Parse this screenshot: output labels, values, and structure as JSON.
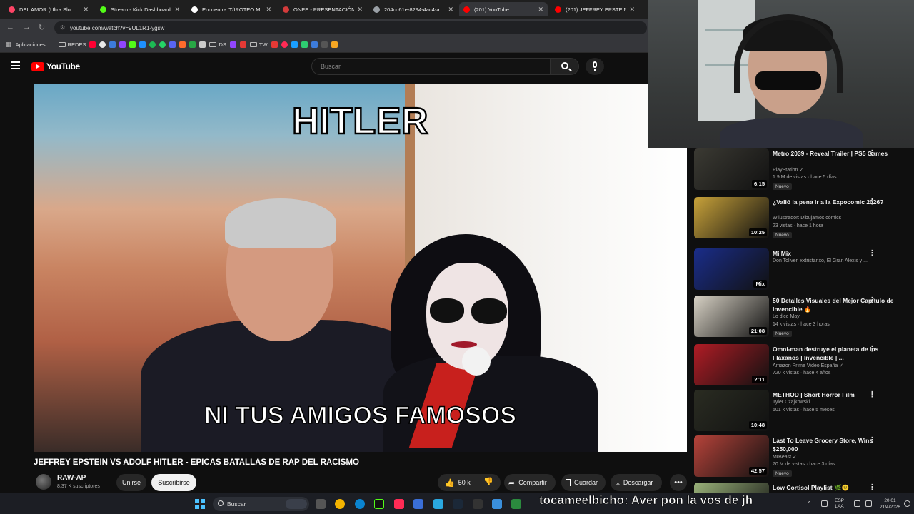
{
  "browser": {
    "tabs": [
      {
        "title": "DEL AMOR (Ultra Slo",
        "color": "#ff4466",
        "active": false
      },
      {
        "title": "Stream - Kick Dashboard",
        "color": "#53fc18",
        "active": false
      },
      {
        "title": "Encuentra 'T/IROTEO MI",
        "color": "#ffffff",
        "active": false
      },
      {
        "title": "ONPE - PRESENTACIÓN",
        "color": "#d33b3b",
        "active": false
      },
      {
        "title": "204cd61e-8294-4ac4-a",
        "color": "#9aa0a6",
        "active": false
      },
      {
        "title": "(201) YouTube",
        "color": "#ff0000",
        "active": true
      },
      {
        "title": "(201) JEFFREY EPSTEIN V",
        "color": "#ff0000",
        "active": false
      }
    ],
    "url": "youtube.com/watch?v=9UL1R1-ygsw",
    "bookmarks": {
      "apps_label": "Aplicaciones",
      "folders": [
        "REDES",
        "DS",
        "TW"
      ]
    }
  },
  "youtube": {
    "logo_text": "YouTube",
    "search_placeholder": "Buscar",
    "video": {
      "caption_top": "HITLER",
      "caption_bottom": "NI TUS AMIGOS FAMOSOS",
      "title": "JEFFREY EPSTEIN VS ADOLF HITLER - EPICAS BATALLAS DE RAP DEL RACISMO",
      "channel": "RAW-AP",
      "subscribers": "8.37 K suscriptores",
      "join_label": "Unirse",
      "subscribe_label": "Suscribirse",
      "likes": "50 k",
      "share_label": "Compartir",
      "save_label": "Guardar",
      "download_label": "Descargar"
    },
    "recommendations": [
      {
        "title": "Metro 2039 - Reveal Trailer | PS5 Games",
        "channel": "PlayStation ✓",
        "meta": "1.9 M de vistas · hace 5 días",
        "badge": "Nuevo",
        "duration": "6:15",
        "thumb": "#3b3a33"
      },
      {
        "title": "¿Valió la pena ir a la Expocomic 2026?",
        "channel": "Wilustrador: Dibujamos cómics",
        "meta": "23 vistas · hace 1 hora",
        "badge": "Nuevo",
        "duration": "10:25",
        "thumb": "#c8a23a"
      },
      {
        "title": "Mi Mix",
        "channel": "Don Toliver, xxtristanxo, El Gran Alexis y ...",
        "meta": "",
        "badge": "",
        "duration": "Mix",
        "thumb": "#1a2d8a"
      },
      {
        "title": "50 Detalles Visuales del Mejor Capítulo de Invencible 🔥",
        "channel": "Lo dice May",
        "meta": "14 k vistas · hace 3 horas",
        "badge": "Nuevo",
        "duration": "21:08",
        "thumb": "#d8d2c5"
      },
      {
        "title": "Omni-man destruye el planeta de los Flaxanos | Invencible | ...",
        "channel": "Amazon Prime Video España ✓",
        "meta": "720 k vistas · hace 4 años",
        "badge": "",
        "duration": "2:11",
        "thumb": "#b01c25"
      },
      {
        "title": "METHOD | Short Horror Film",
        "channel": "Tyler Czajkowski",
        "meta": "501 k vistas · hace 5 meses",
        "badge": "",
        "duration": "10:48",
        "thumb": "#2a2c22"
      },
      {
        "title": "Last To Leave Grocery Store, Wins $250,000",
        "channel": "MrBeast ✓",
        "meta": "70 M de vistas · hace 3 días",
        "badge": "Nuevo",
        "duration": "42:57",
        "thumb": "#b6433a"
      },
      {
        "title": "Low Cortisol Playlist 🌿🙂",
        "channel": "",
        "meta": "",
        "badge": "",
        "duration": "",
        "thumb": "#9ab27a"
      }
    ]
  },
  "stream_overlay": {
    "chat_text": "tocameelbicho: Aver pon la vos de jh"
  },
  "taskbar": {
    "search_label": "Buscar",
    "lang_top": "ESP",
    "lang_bottom": "LAA",
    "time": "20:01",
    "date": "21/4/2026"
  }
}
